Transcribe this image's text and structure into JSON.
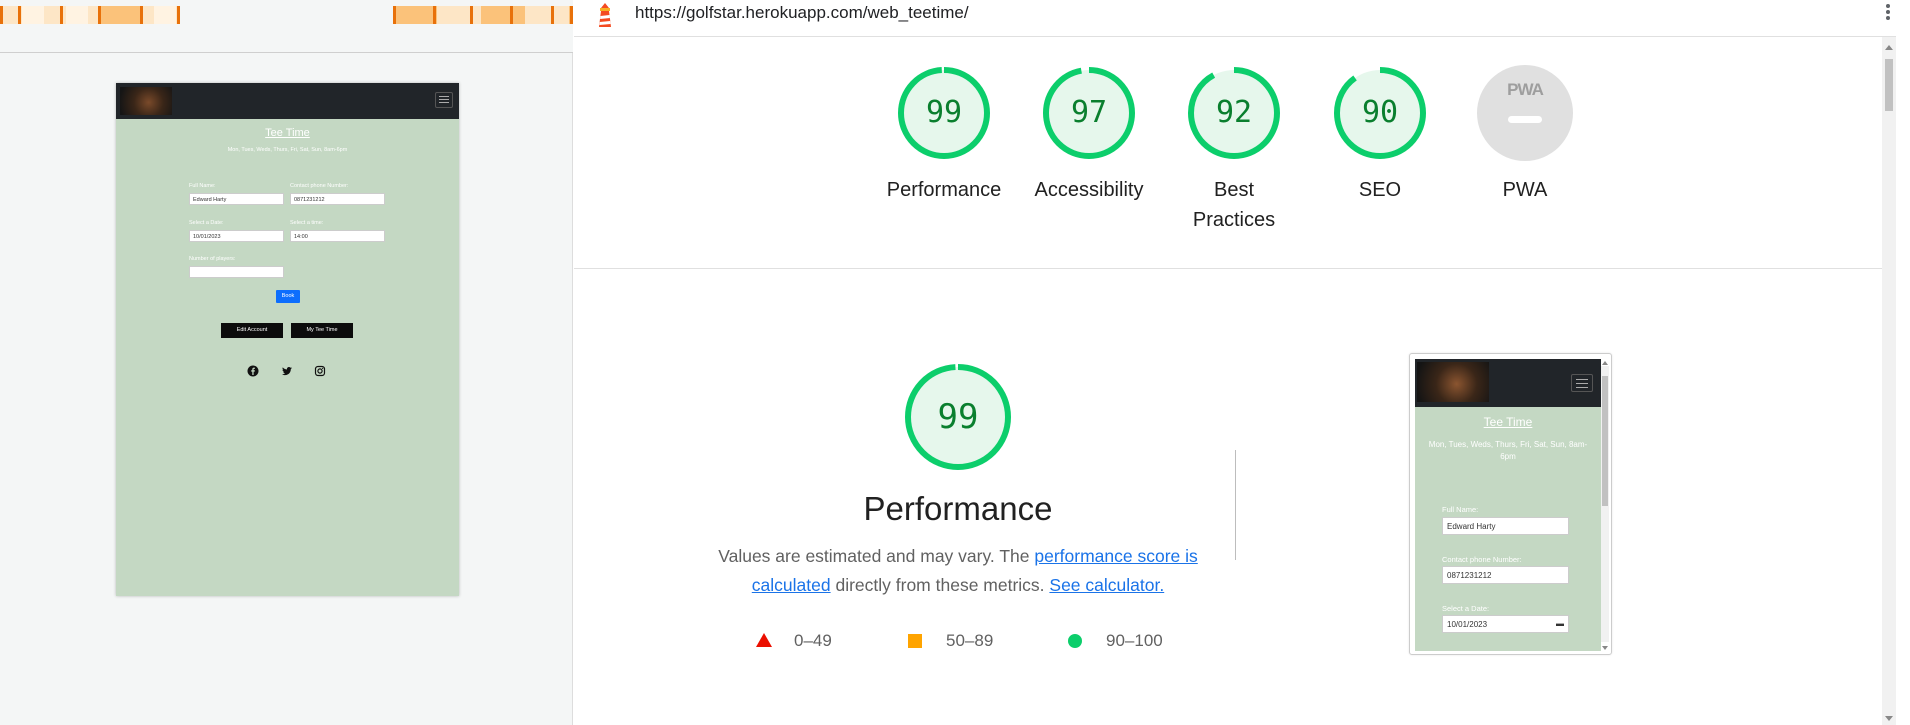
{
  "browser": {
    "url": "https://golfstar.herokuapp.com/web_teetime/"
  },
  "categories": [
    {
      "label": "Performance",
      "score": 99,
      "color": "#0cce6b"
    },
    {
      "label": "Accessibility",
      "score": 97,
      "color": "#0cce6b"
    },
    {
      "label": "Best Practices",
      "score": 92,
      "color": "#0cce6b"
    },
    {
      "label": "SEO",
      "score": 90,
      "color": "#0cce6b"
    },
    {
      "label": "PWA",
      "score": null,
      "badge": "PWA",
      "color": "#9e9e9e"
    }
  ],
  "performance": {
    "score": 99,
    "title": "Performance",
    "desc_before": "Values are estimated and may vary. The ",
    "link1": "performance score is calculated",
    "desc_middle": " directly from these metrics. ",
    "link2": "See calculator."
  },
  "legend": [
    {
      "range": "0–49",
      "shape": "triangle",
      "color": "#eb0f00"
    },
    {
      "range": "50–89",
      "shape": "square",
      "color": "#ffa400"
    },
    {
      "range": "90–100",
      "shape": "circle",
      "color": "#0cce6b"
    }
  ],
  "thumbnail": {
    "title": "Tee Time",
    "hours": "Mon, Tues, Weds, Thurs, Fri, Sat, Sun, 8am-6pm",
    "full_name_label": "Full Name:",
    "full_name_value": "Edward Harty",
    "phone_label": "Contact phone Number:",
    "phone_value": "0871231212",
    "date_label": "Select a Date:",
    "date_value": "10/01/2023",
    "time_label": "Select a time:",
    "time_value": "14:00",
    "players_label": "Number of players:",
    "book_label": "Book",
    "edit_account_label": "Edit Account",
    "my_tee_time_label": "My Tee Time"
  }
}
